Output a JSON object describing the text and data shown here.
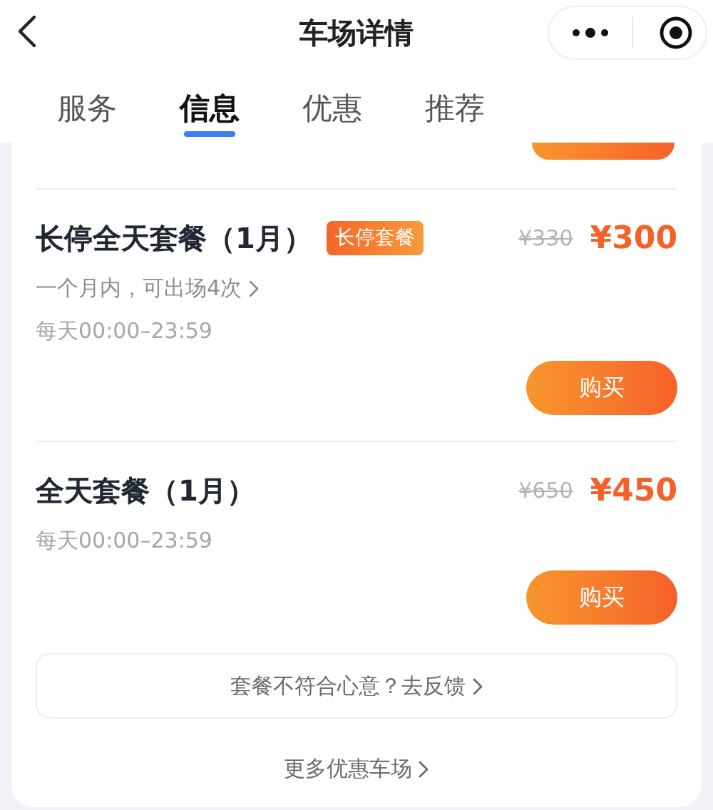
{
  "header": {
    "title": "车场详情"
  },
  "tabs": [
    {
      "label": "服务",
      "selected": false
    },
    {
      "label": "信息",
      "selected": true
    },
    {
      "label": "优惠",
      "selected": false
    },
    {
      "label": "推荐",
      "selected": false
    }
  ],
  "packages": [
    {
      "name": "长停全天套餐（1月）",
      "tag": "长停套餐",
      "original_price": "¥330",
      "price": "¥300",
      "notes": [
        {
          "text": "一个月内，可出场4次",
          "kind": "link"
        },
        {
          "text": "每天00:00–23:59",
          "kind": "hours"
        }
      ],
      "button": "购买"
    },
    {
      "name": "全天套餐（1月）",
      "original_price": "¥650",
      "price": "¥450",
      "notes": [
        {
          "text": "每天00:00–23:59",
          "kind": "hours"
        }
      ],
      "button": "购买"
    }
  ],
  "feedback": "套餐不符合心意？去反馈",
  "more_link": "更多优惠车场"
}
